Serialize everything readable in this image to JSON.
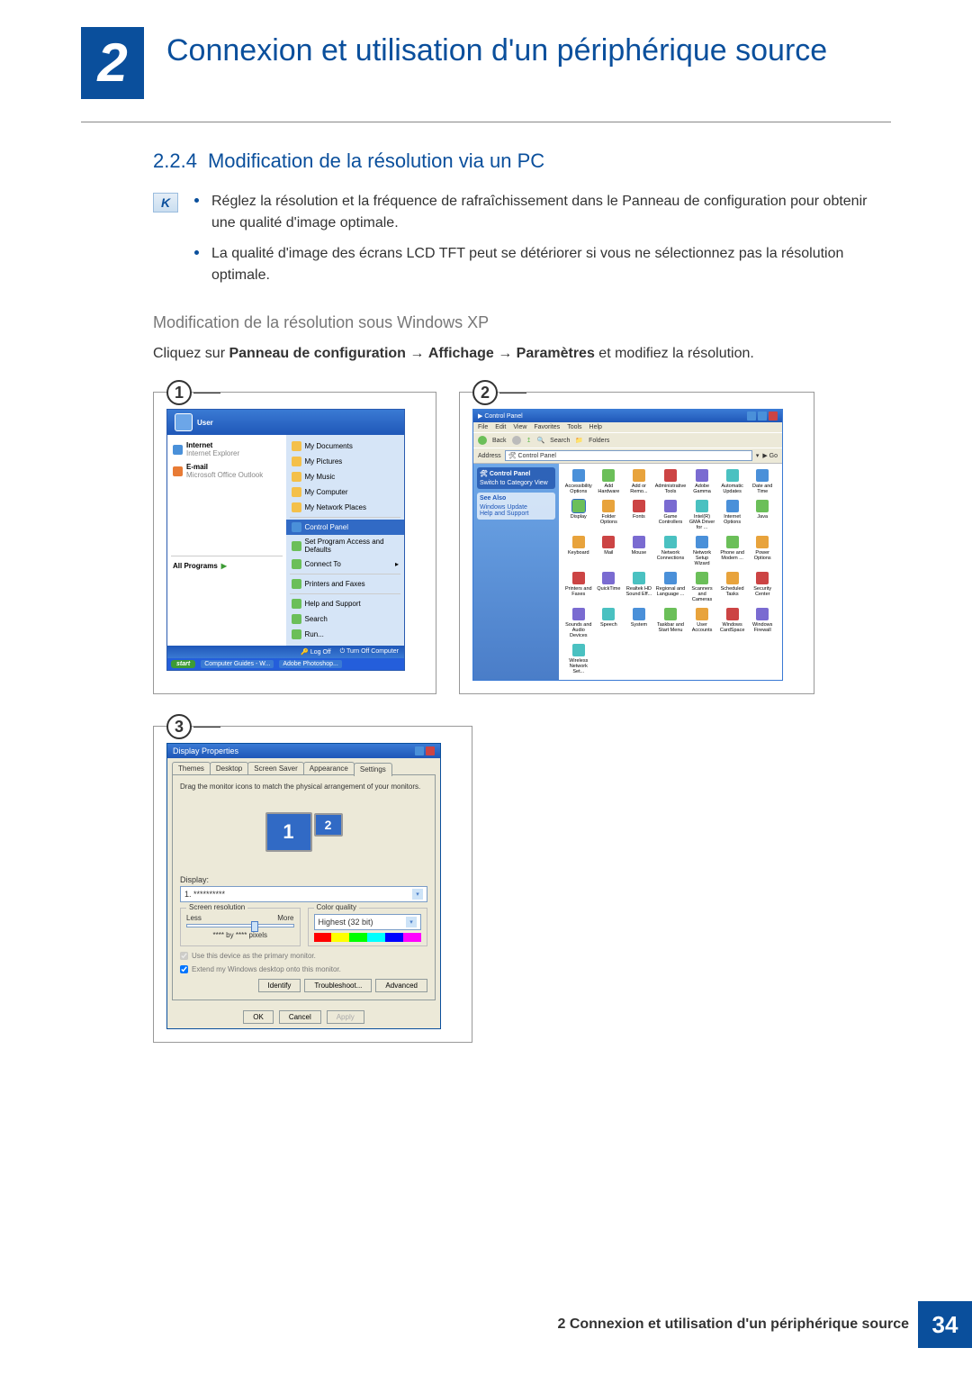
{
  "header": {
    "chapter_number": "2",
    "chapter_title": "Connexion et utilisation d'un périphérique source"
  },
  "section": {
    "number": "2.2.4",
    "title": "Modification de la résolution via un PC"
  },
  "note_icon_glyph": "K",
  "bullets": [
    "Réglez la résolution et la fréquence de rafraîchissement dans le Panneau de configuration pour obtenir une qualité d'image optimale.",
    "La qualité d'image des écrans LCD TFT peut se détériorer si vous ne sélectionnez pas la résolution optimale."
  ],
  "sub_heading": "Modification de la résolution sous Windows XP",
  "instruction": {
    "prefix": "Cliquez sur ",
    "b1": "Panneau de configuration",
    "arrow": " → ",
    "b2": "Affichage",
    "b3": "Paramètres",
    "suffix": " et modifiez la résolution."
  },
  "shots": {
    "s1": {
      "num": "1",
      "user": "User",
      "left": [
        {
          "t": "Internet",
          "sub": "Internet Explorer"
        },
        {
          "t": "E-mail",
          "sub": "Microsoft Office Outlook"
        }
      ],
      "all_programs": "All Programs",
      "right": [
        "My Documents",
        "My Pictures",
        "My Music",
        "My Computer",
        "My Network Places",
        "Control Panel",
        "Set Program Access and Defaults",
        "Connect To",
        "Printers and Faxes",
        "Help and Support",
        "Search",
        "Run..."
      ],
      "right_highlight_index": 5,
      "footer": [
        "Log Off",
        "Turn Off Computer"
      ],
      "taskbar": {
        "start": "start",
        "items": [
          "Computer Guides - W...",
          "Adobe Photoshop..."
        ]
      }
    },
    "s2": {
      "num": "2",
      "title": "Control Panel",
      "menu": [
        "File",
        "Edit",
        "View",
        "Favorites",
        "Tools",
        "Help"
      ],
      "toolbar": [
        "Back",
        "",
        "",
        "Search",
        "Folders"
      ],
      "address_label": "Address",
      "address_value": "Control Panel",
      "go": "Go",
      "side": {
        "panel_title": "Control Panel",
        "switch": "Switch to Category View",
        "see_also": "See Also",
        "links": [
          "Windows Update",
          "Help and Support"
        ]
      },
      "icons": [
        "Accessibility Options",
        "Add Hardware",
        "Add or Remo...",
        "Administrative Tools",
        "Adobe Gamma",
        "Automatic Updates",
        "Date and Time",
        "Display",
        "Folder Options",
        "Fonts",
        "Game Controllers",
        "Intel(R) GMA Driver for ...",
        "Internet Options",
        "Java",
        "Keyboard",
        "Mail",
        "Mouse",
        "Network Connections",
        "Network Setup Wizard",
        "Phone and Modem ...",
        "Power Options",
        "Printers and Faxes",
        "QuickTime",
        "Realtek HD Sound Eff...",
        "Regional and Language ...",
        "Scanners and Cameras",
        "Scheduled Tasks",
        "Security Center",
        "Sounds and Audio Devices",
        "Speech",
        "System",
        "Taskbar and Start Menu",
        "User Accounts",
        "Windows CardSpace",
        "Windows Firewall",
        "Wireless Network Set..."
      ],
      "selected_icon_index": 7
    },
    "s3": {
      "num": "3",
      "title": "Display Properties",
      "tabs": [
        "Themes",
        "Desktop",
        "Screen Saver",
        "Appearance",
        "Settings"
      ],
      "active_tab_index": 4,
      "drag_text": "Drag the monitor icons to match the physical arrangement of your monitors.",
      "monitors": [
        "1",
        "2"
      ],
      "display_label": "Display:",
      "display_value": "1. **********",
      "group_res": {
        "title": "Screen resolution",
        "less": "Less",
        "more": "More",
        "value": "**** by **** pixels"
      },
      "group_color": {
        "title": "Color quality",
        "value": "Highest (32 bit)"
      },
      "check1": "Use this device as the primary monitor.",
      "check2": "Extend my Windows desktop onto this monitor.",
      "btns_mid": [
        "Identify",
        "Troubleshoot...",
        "Advanced"
      ],
      "btns_bottom": [
        "OK",
        "Cancel",
        "Apply"
      ]
    }
  },
  "footer": {
    "text": "2 Connexion et utilisation d'un périphérique source",
    "page": "34"
  }
}
